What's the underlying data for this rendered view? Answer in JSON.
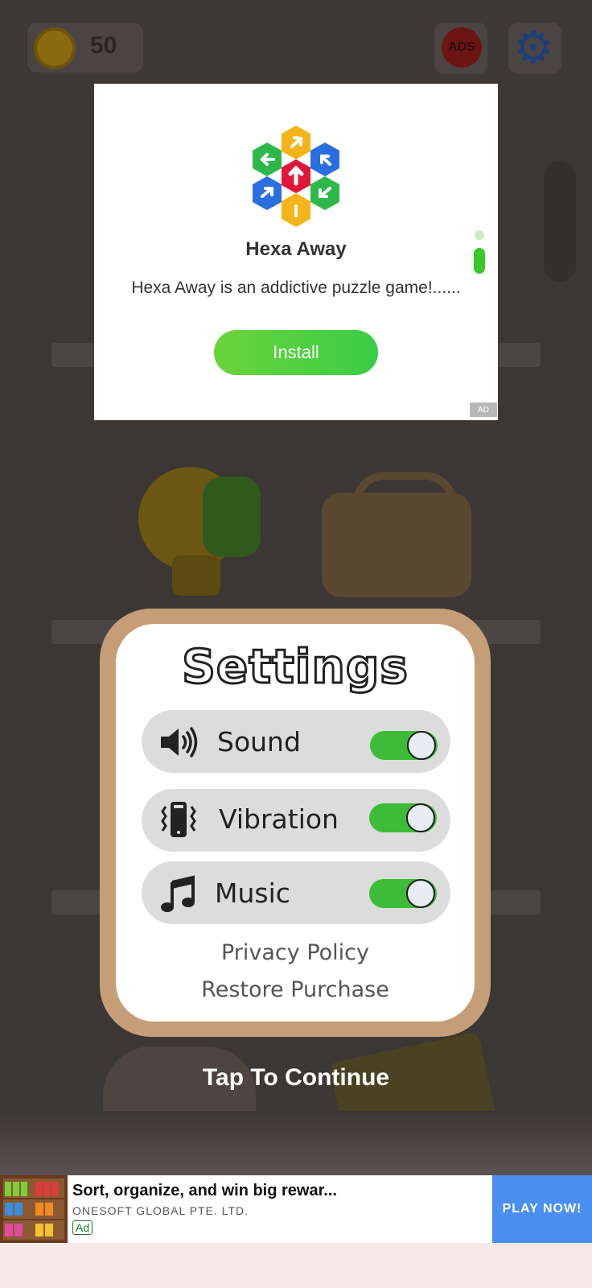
{
  "hud": {
    "coin_count": "50",
    "noads_label": "ADS"
  },
  "ad_popup": {
    "app_title": "Hexa Away",
    "description": "Hexa Away is an addictive puzzle game!......",
    "install_label": "Install",
    "ad_badge": "AD"
  },
  "settings": {
    "title": "Settings",
    "rows": [
      {
        "label": "Sound",
        "icon": "speaker-icon",
        "enabled": true
      },
      {
        "label": "Vibration",
        "icon": "vibration-icon",
        "enabled": true
      },
      {
        "label": "Music",
        "icon": "music-note-icon",
        "enabled": true
      }
    ],
    "privacy_label": "Privacy Policy",
    "restore_label": "Restore Purchase"
  },
  "tap_to_continue": "Tap To Continue",
  "banner": {
    "title": "Sort, organize, and win big rewar...",
    "publisher": "ONESOFT GLOBAL PTE. LTD.",
    "ad_tag": "Ad",
    "cta": "PLAY NOW!"
  },
  "colors": {
    "toggle_on": "#3fbb3a",
    "install_green": "#39cc48",
    "frame_tan": "#c59e78",
    "cta_blue": "#4a8ff0"
  }
}
